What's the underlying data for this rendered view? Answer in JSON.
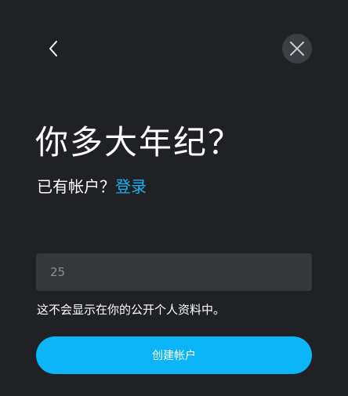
{
  "header": {
    "back_icon": "chevron-left-icon",
    "close_icon": "close-icon"
  },
  "title": "你多大年纪？",
  "subtitle": {
    "prompt": "已有帐户？",
    "login_link": "登录"
  },
  "age_input": {
    "placeholder": "25",
    "value": ""
  },
  "helper_text": "这不会显示在你的公开个人资料中。",
  "create_button": {
    "label": "创建帐户"
  },
  "colors": {
    "background": "#1f2124",
    "accent": "#0bb5f8",
    "link": "#1ab0f5",
    "input_background": "#35373b",
    "close_button_background": "#3b3e42"
  }
}
